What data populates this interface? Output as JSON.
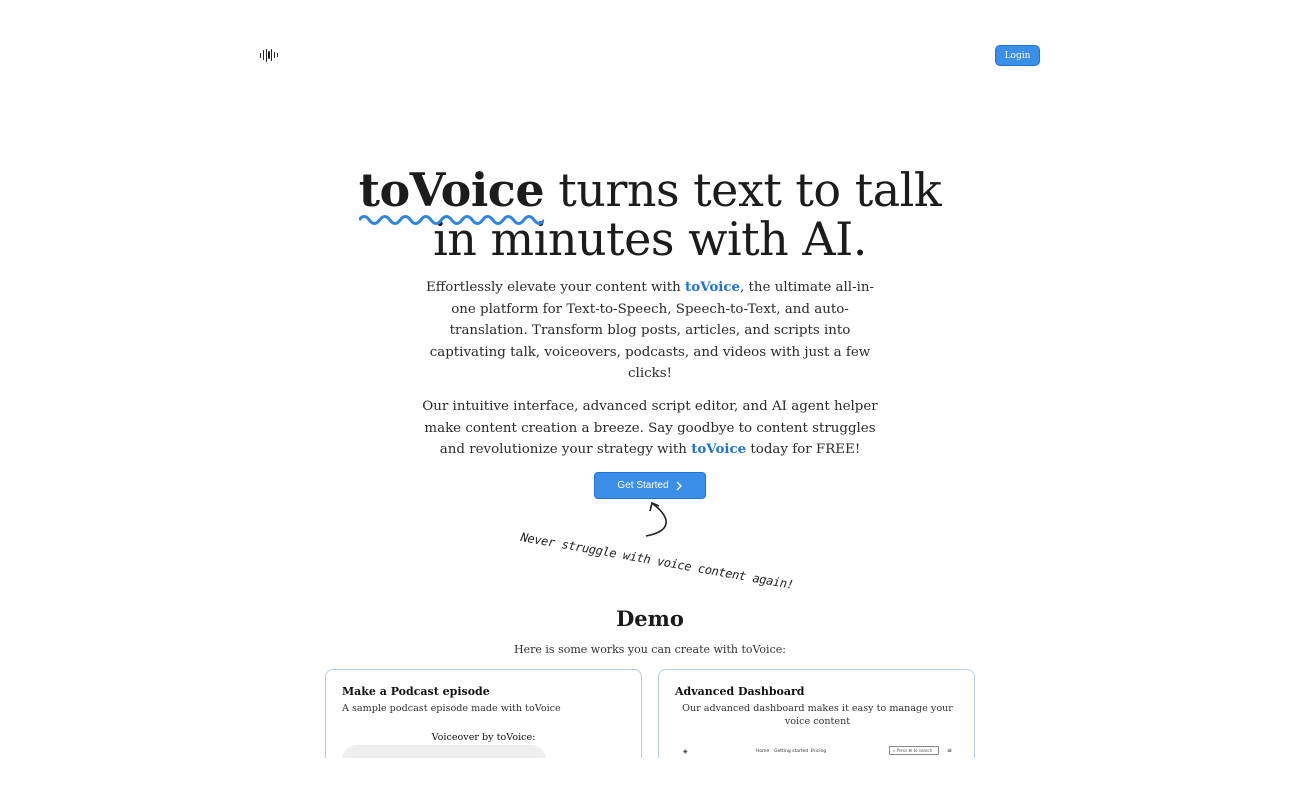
{
  "header": {
    "logo_icon": "audio-waveform-icon",
    "login_label": "Login"
  },
  "hero": {
    "brand": "toVoice",
    "title_rest_line1": " turns text to talk",
    "title_line2": "in minutes with AI.",
    "p1_before": "Effortlessly elevate your content with ",
    "p1_brand": "toVoice",
    "p1_after": ", the ultimate all-in-one platform for Text-to-Speech, Speech-to-Text, and auto-translation. Transform blog posts, articles, and scripts into captivating talk, voiceovers, podcasts, and videos with just a few clicks!",
    "p2_before": "Our intuitive interface, advanced script editor, and AI agent helper make content creation a breeze. Say goodbye to content struggles and revolutionize your strategy with ",
    "p2_brand": "toVoice",
    "p2_after": " today for FREE!",
    "cta_label": "Get Started",
    "handwriting": "Never struggle with voice content again!"
  },
  "demo": {
    "title": "Demo",
    "subtitle": "Here is some works you can create with toVoice:",
    "cards": [
      {
        "title": "Make a Podcast episode",
        "description": "A sample podcast episode made with toVoice",
        "voiceover_label": "Voiceover by toVoice:"
      },
      {
        "title": "Advanced Dashboard",
        "description": "Our advanced dashboard makes it easy to manage your voice content",
        "mini_nav": [
          "Home",
          "Getting started ⌄",
          "Pricing"
        ],
        "mini_search": "⌕ Press ⌘ to search",
        "mini_menu_icon": "menu-icon"
      }
    ]
  },
  "colors": {
    "accent": "#3b8fe8",
    "accent_dark": "#1f74d6"
  }
}
